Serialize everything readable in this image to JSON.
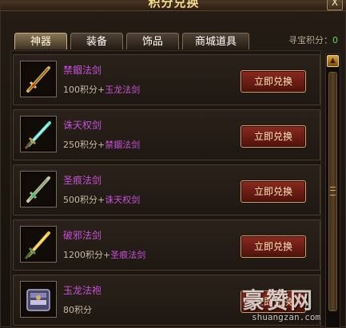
{
  "window": {
    "title": "积分兑换",
    "close_label": "X"
  },
  "tabs": [
    {
      "label": "神器",
      "active": true
    },
    {
      "label": "装备",
      "active": false
    },
    {
      "label": "饰品",
      "active": false
    },
    {
      "label": "商城道具",
      "active": false
    }
  ],
  "points": {
    "label": "寻宝积分：",
    "value": "0"
  },
  "items": [
    {
      "name": "禁錮法剑",
      "cost": "100积分+",
      "requires": "玉龙法剑",
      "button": "立即兑换",
      "icon": "golden-sword-icon"
    },
    {
      "name": "诛天权剑",
      "cost": "250积分+",
      "requires": "禁錮法剑",
      "button": "立即兑换",
      "icon": "cyan-sword-icon"
    },
    {
      "name": "圣痕法剑",
      "cost": "500积分+",
      "requires": "诛天权剑",
      "button": "立即兑换",
      "icon": "jade-sword-icon"
    },
    {
      "name": "破邪法剑",
      "cost": "1200积分+",
      "requires": "圣痕法剑",
      "button": "立即兑换",
      "icon": "flame-sword-icon"
    },
    {
      "name": "玉龙法袍",
      "cost": "80积分",
      "requires": "",
      "button": "立即兑换",
      "icon": "robe-icon"
    }
  ],
  "watermark": {
    "main": "豪赞网",
    "sub": "shuangzan.com"
  },
  "colors": {
    "item_name": "#c552d6",
    "points_value": "#62d862",
    "button": "#7a2118"
  }
}
